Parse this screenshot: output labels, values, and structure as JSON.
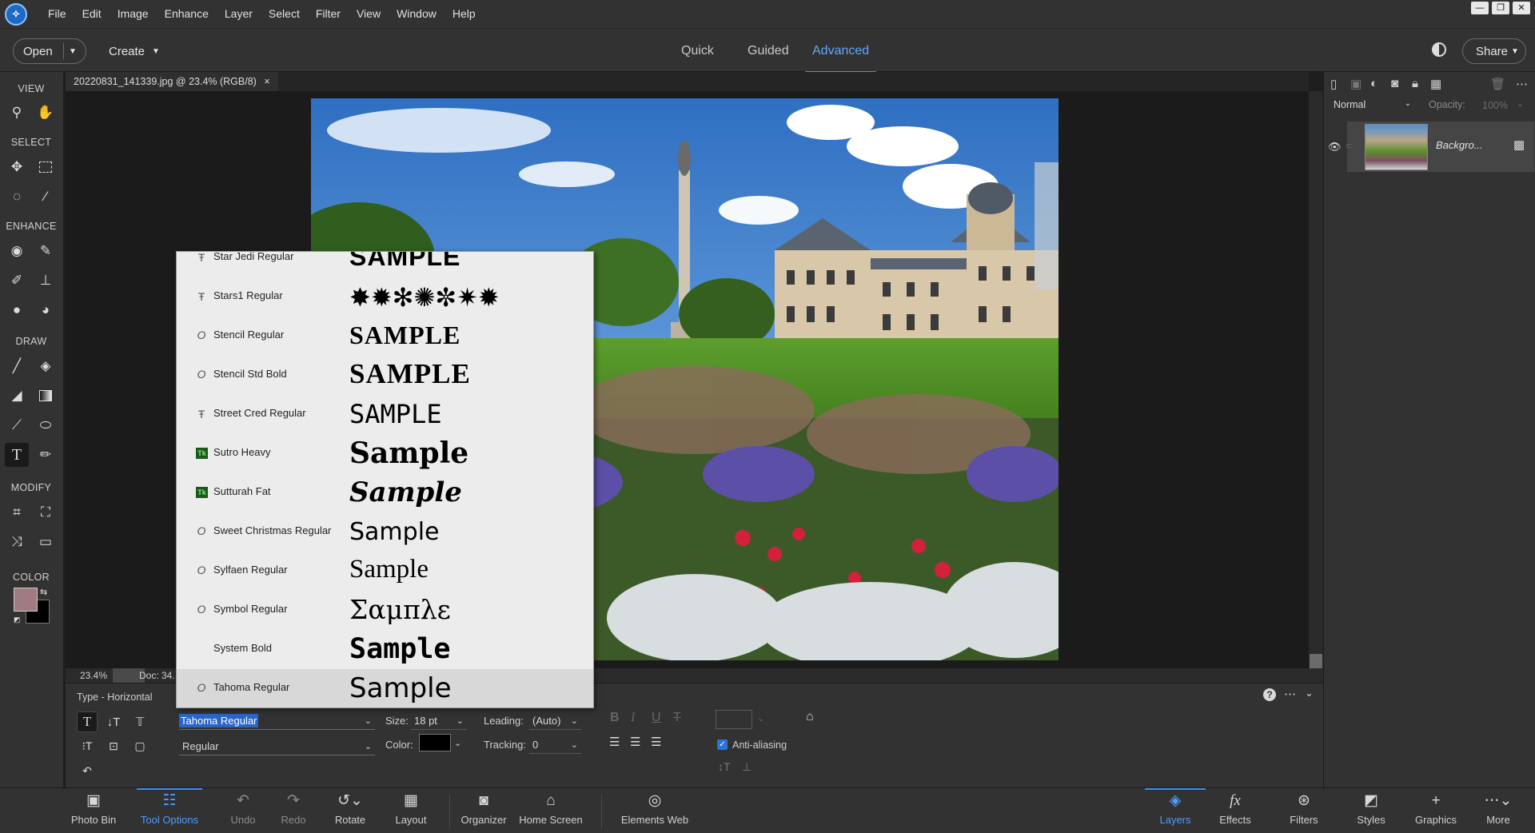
{
  "app": {
    "logo_icon": "elements-logo-icon"
  },
  "menu": [
    "File",
    "Edit",
    "Image",
    "Enhance",
    "Layer",
    "Select",
    "Filter",
    "View",
    "Window",
    "Help"
  ],
  "modebar": {
    "open_label": "Open",
    "create_label": "Create",
    "tabs": [
      "Quick",
      "Guided",
      "Advanced"
    ],
    "active_tab": "Advanced",
    "share_label": "Share"
  },
  "toolbox": {
    "sections": [
      "VIEW",
      "SELECT",
      "ENHANCE",
      "DRAW",
      "MODIFY",
      "COLOR"
    ],
    "foreground_color": "#a07b82",
    "background_color": "#000000"
  },
  "document": {
    "tab_title": "20220831_141339.jpg @ 23.4% (RGB/8)",
    "close": "×",
    "zoom": "23.4%",
    "doc_info": "Doc: 34."
  },
  "layers_panel": {
    "blend_mode": "Normal",
    "opacity_label": "Opacity:",
    "opacity_value": "100%",
    "layer_name": "Backgro..."
  },
  "font_list": [
    {
      "type": "tt",
      "name": "Star Jedi Regular",
      "sample": "SAMPLE"
    },
    {
      "type": "tt",
      "name": "Stars1 Regular",
      "sample": "✸✹✻✺✼✷✹"
    },
    {
      "type": "otf",
      "name": "Stencil Regular",
      "sample": "SAMPLE"
    },
    {
      "type": "otf",
      "name": "Stencil Std Bold",
      "sample": "SAMPLE"
    },
    {
      "type": "tt",
      "name": "Street Cred Regular",
      "sample": "SAMPLE"
    },
    {
      "type": "tk",
      "name": "Sutro  Heavy",
      "sample": "Sample"
    },
    {
      "type": "tk",
      "name": "Sutturah Fat",
      "sample": "Sample"
    },
    {
      "type": "otf",
      "name": "Sweet Christmas Regular",
      "sample": "Sample"
    },
    {
      "type": "otf",
      "name": "Sylfaen Regular",
      "sample": "Sample"
    },
    {
      "type": "otf",
      "name": "Symbol Regular",
      "sample": "Σαμπλε"
    },
    {
      "type": "none",
      "name": "System Bold",
      "sample": "Sample"
    },
    {
      "type": "otf",
      "name": "Tahoma Regular",
      "sample": "Sample"
    }
  ],
  "tool_options": {
    "title": "Type - Horizontal",
    "font_value": "Tahoma Regular",
    "style_value": "Regular",
    "size_label": "Size:",
    "size_value": "18 pt",
    "leading_label": "Leading:",
    "leading_value": "(Auto)",
    "color_label": "Color:",
    "color_value": "#000000",
    "tracking_label": "Tracking:",
    "tracking_value": "0",
    "anti_aliasing_label": "Anti-aliasing",
    "anti_aliasing_checked": true
  },
  "bottom_bar": {
    "left": [
      "Photo Bin",
      "Tool Options",
      "Undo",
      "Redo",
      "Rotate",
      "Layout",
      "Organizer",
      "Home Screen",
      "Elements Web"
    ],
    "right": [
      "Layers",
      "Effects",
      "Filters",
      "Styles",
      "Graphics",
      "More"
    ]
  }
}
